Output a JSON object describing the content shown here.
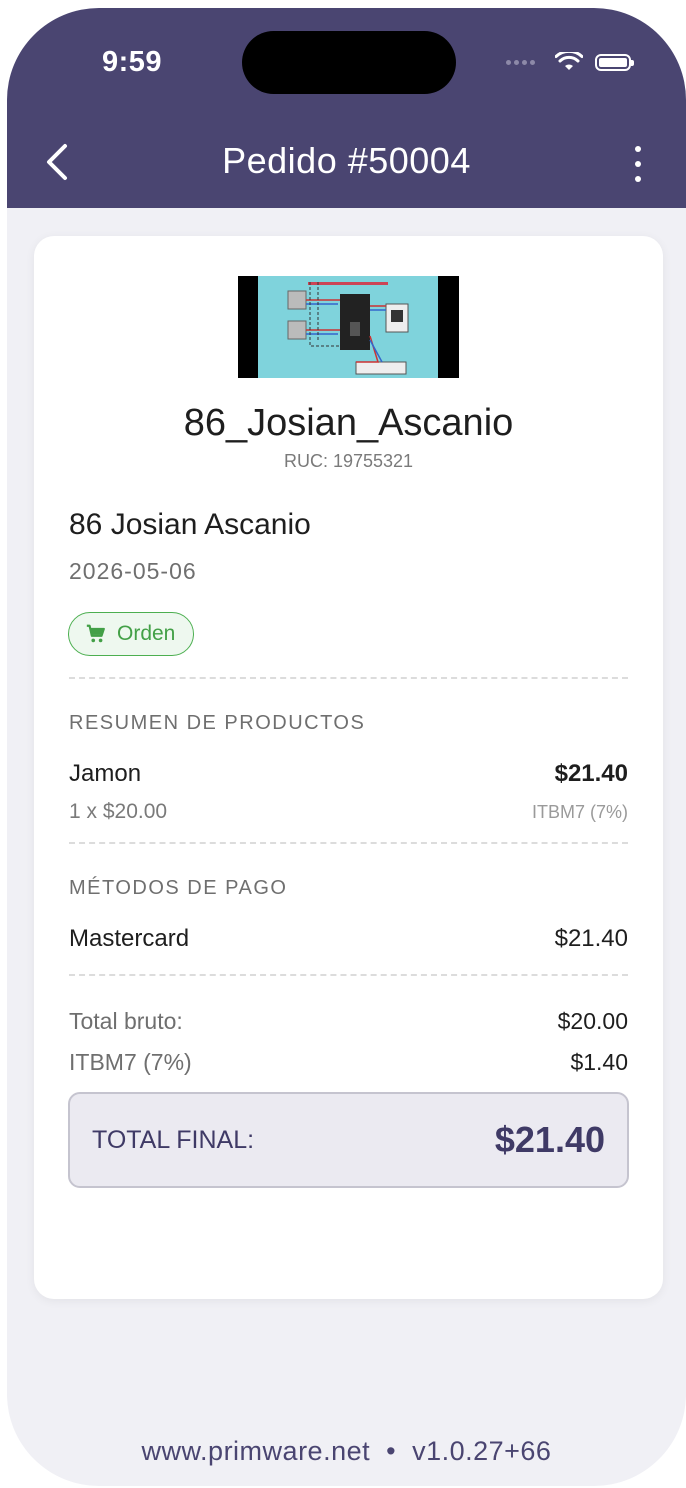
{
  "status_bar": {
    "time": "9:59"
  },
  "header": {
    "title": "Pedido #50004"
  },
  "customer": {
    "company": "86_Josian_Ascanio",
    "ruc": "RUC: 19755321",
    "name": "86 Josian Ascanio",
    "date": "2026-05-06",
    "badge": "Orden"
  },
  "products": {
    "section_title": "RESUMEN DE PRODUCTOS",
    "items": [
      {
        "name": "Jamon",
        "price": "$21.40",
        "qty_line": "1 x $20.00",
        "tax": "ITBM7 (7%)"
      }
    ]
  },
  "payments": {
    "section_title": "MÉTODOS DE PAGO",
    "items": [
      {
        "method": "Mastercard",
        "amount": "$21.40"
      }
    ]
  },
  "summary": {
    "gross_label": "Total bruto:",
    "gross_value": "$20.00",
    "tax_label": "ITBM7 (7%)",
    "tax_value": "$1.40",
    "total_label": "TOTAL FINAL:",
    "total_value": "$21.40"
  },
  "footer": {
    "text": "www.primware.net  •  v1.0.27+66"
  },
  "colors": {
    "header": "#4a4571",
    "badge_green": "#43a047",
    "total_text": "#3f3a66"
  }
}
